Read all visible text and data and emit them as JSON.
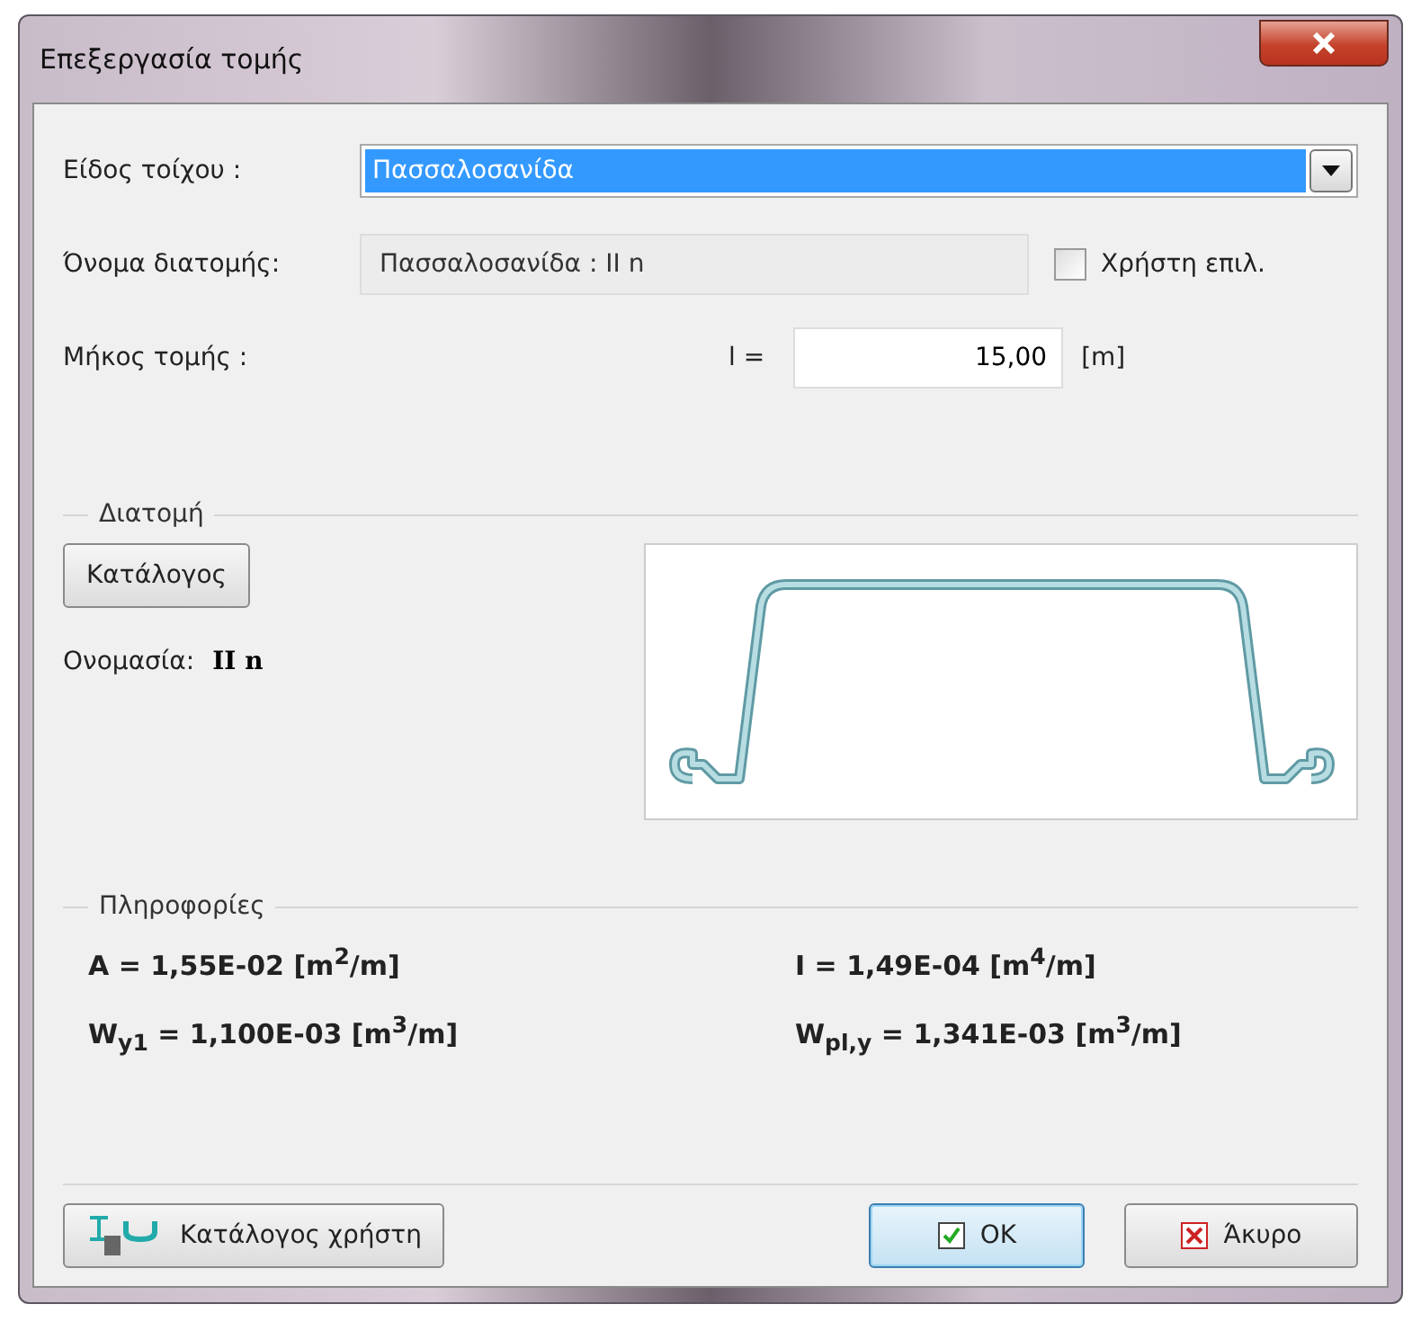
{
  "window": {
    "title": "Επεξεργασία τομής"
  },
  "form": {
    "wall_type": {
      "label": "Είδος τοίχου :",
      "value": "Πασσαλοσανίδα"
    },
    "section_name": {
      "label": "Όνομα διατομής:",
      "value": "Πασσαλοσανίδα : II n"
    },
    "user_choice": {
      "label": "Χρήστη επιλ.",
      "checked": false
    },
    "length": {
      "label": "Μήκος τομής :",
      "symbol": "l =",
      "value": "15,00",
      "unit": "[m]"
    }
  },
  "section": {
    "heading": "Διατομή",
    "catalog_button": "Κατάλογος",
    "name_label": "Ονομασία:",
    "name_value": "II n"
  },
  "info": {
    "heading": "Πληροφορίες",
    "properties": [
      {
        "text": "A =  1,55E-02  [m$^{2}$/m]"
      },
      {
        "text": "I =  1,49E-04  [m$^{4}$/m]"
      },
      {
        "text": "W$_{y1}$ = 1,100E-03  [m$^{3}$/m]"
      },
      {
        "text": "W$_{pl,y}$ = 1,341E-03  [m$^{3}$/m]"
      }
    ]
  },
  "buttons": {
    "user_catalog": "Κατάλογος χρήστη",
    "ok": "OK",
    "cancel": "Άκυρο"
  }
}
